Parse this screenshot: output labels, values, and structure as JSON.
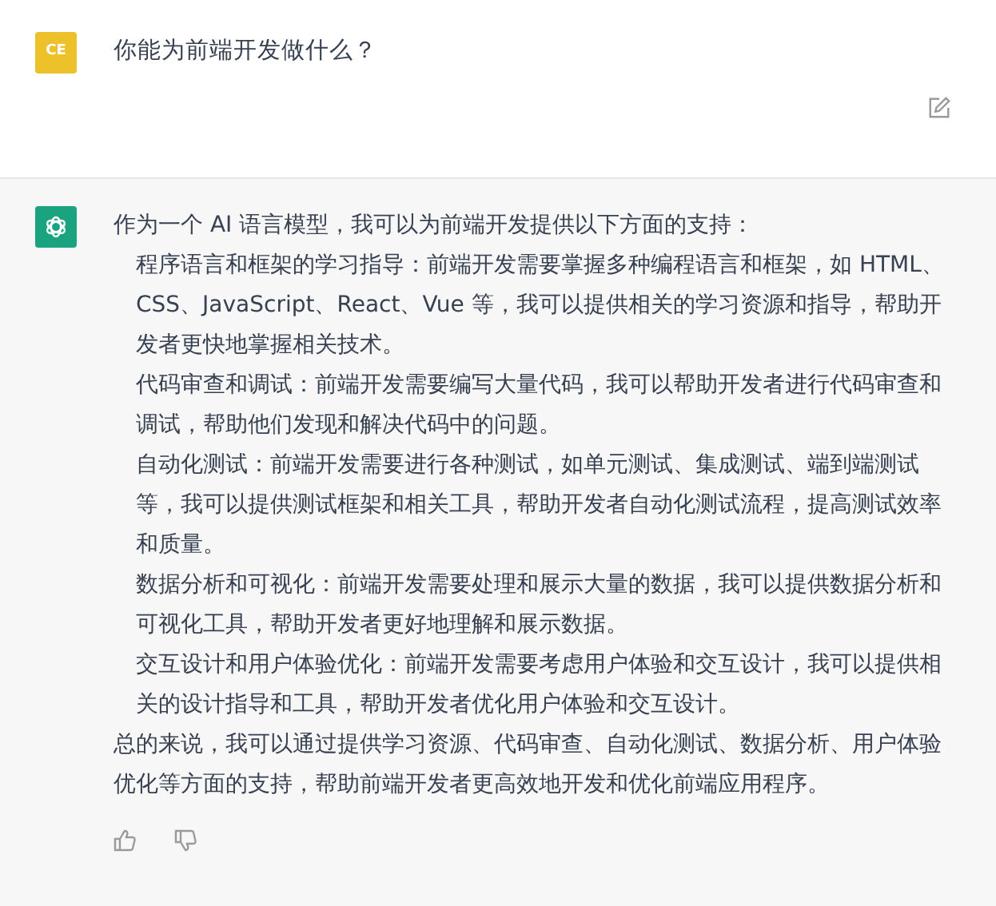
{
  "question": {
    "avatar": "CE",
    "text": "你能为前端开发做什么？"
  },
  "answer": {
    "intro": "作为一个 AI 语言模型，我可以为前端开发提供以下方面的支持：",
    "items": [
      "程序语言和框架的学习指导：前端开发需要掌握多种编程语言和框架，如 HTML、CSS、JavaScript、React、Vue 等，我可以提供相关的学习资源和指导，帮助开发者更快地掌握相关技术。",
      "代码审查和调试：前端开发需要编写大量代码，我可以帮助开发者进行代码审查和调试，帮助他们发现和解决代码中的问题。",
      "自动化测试：前端开发需要进行各种测试，如单元测试、集成测试、端到端测试等，我可以提供测试框架和相关工具，帮助开发者自动化测试流程，提高测试效率和质量。",
      "数据分析和可视化：前端开发需要处理和展示大量的数据，我可以提供数据分析和可视化工具，帮助开发者更好地理解和展示数据。",
      "交互设计和用户体验优化：前端开发需要考虑用户体验和交互设计，我可以提供相关的设计指导和工具，帮助开发者优化用户体验和交互设计。"
    ],
    "summary": "总的来说，我可以通过提供学习资源、代码审查、自动化测试、数据分析、用户体验优化等方面的支持，帮助前端开发者更高效地开发和优化前端应用程序。"
  }
}
